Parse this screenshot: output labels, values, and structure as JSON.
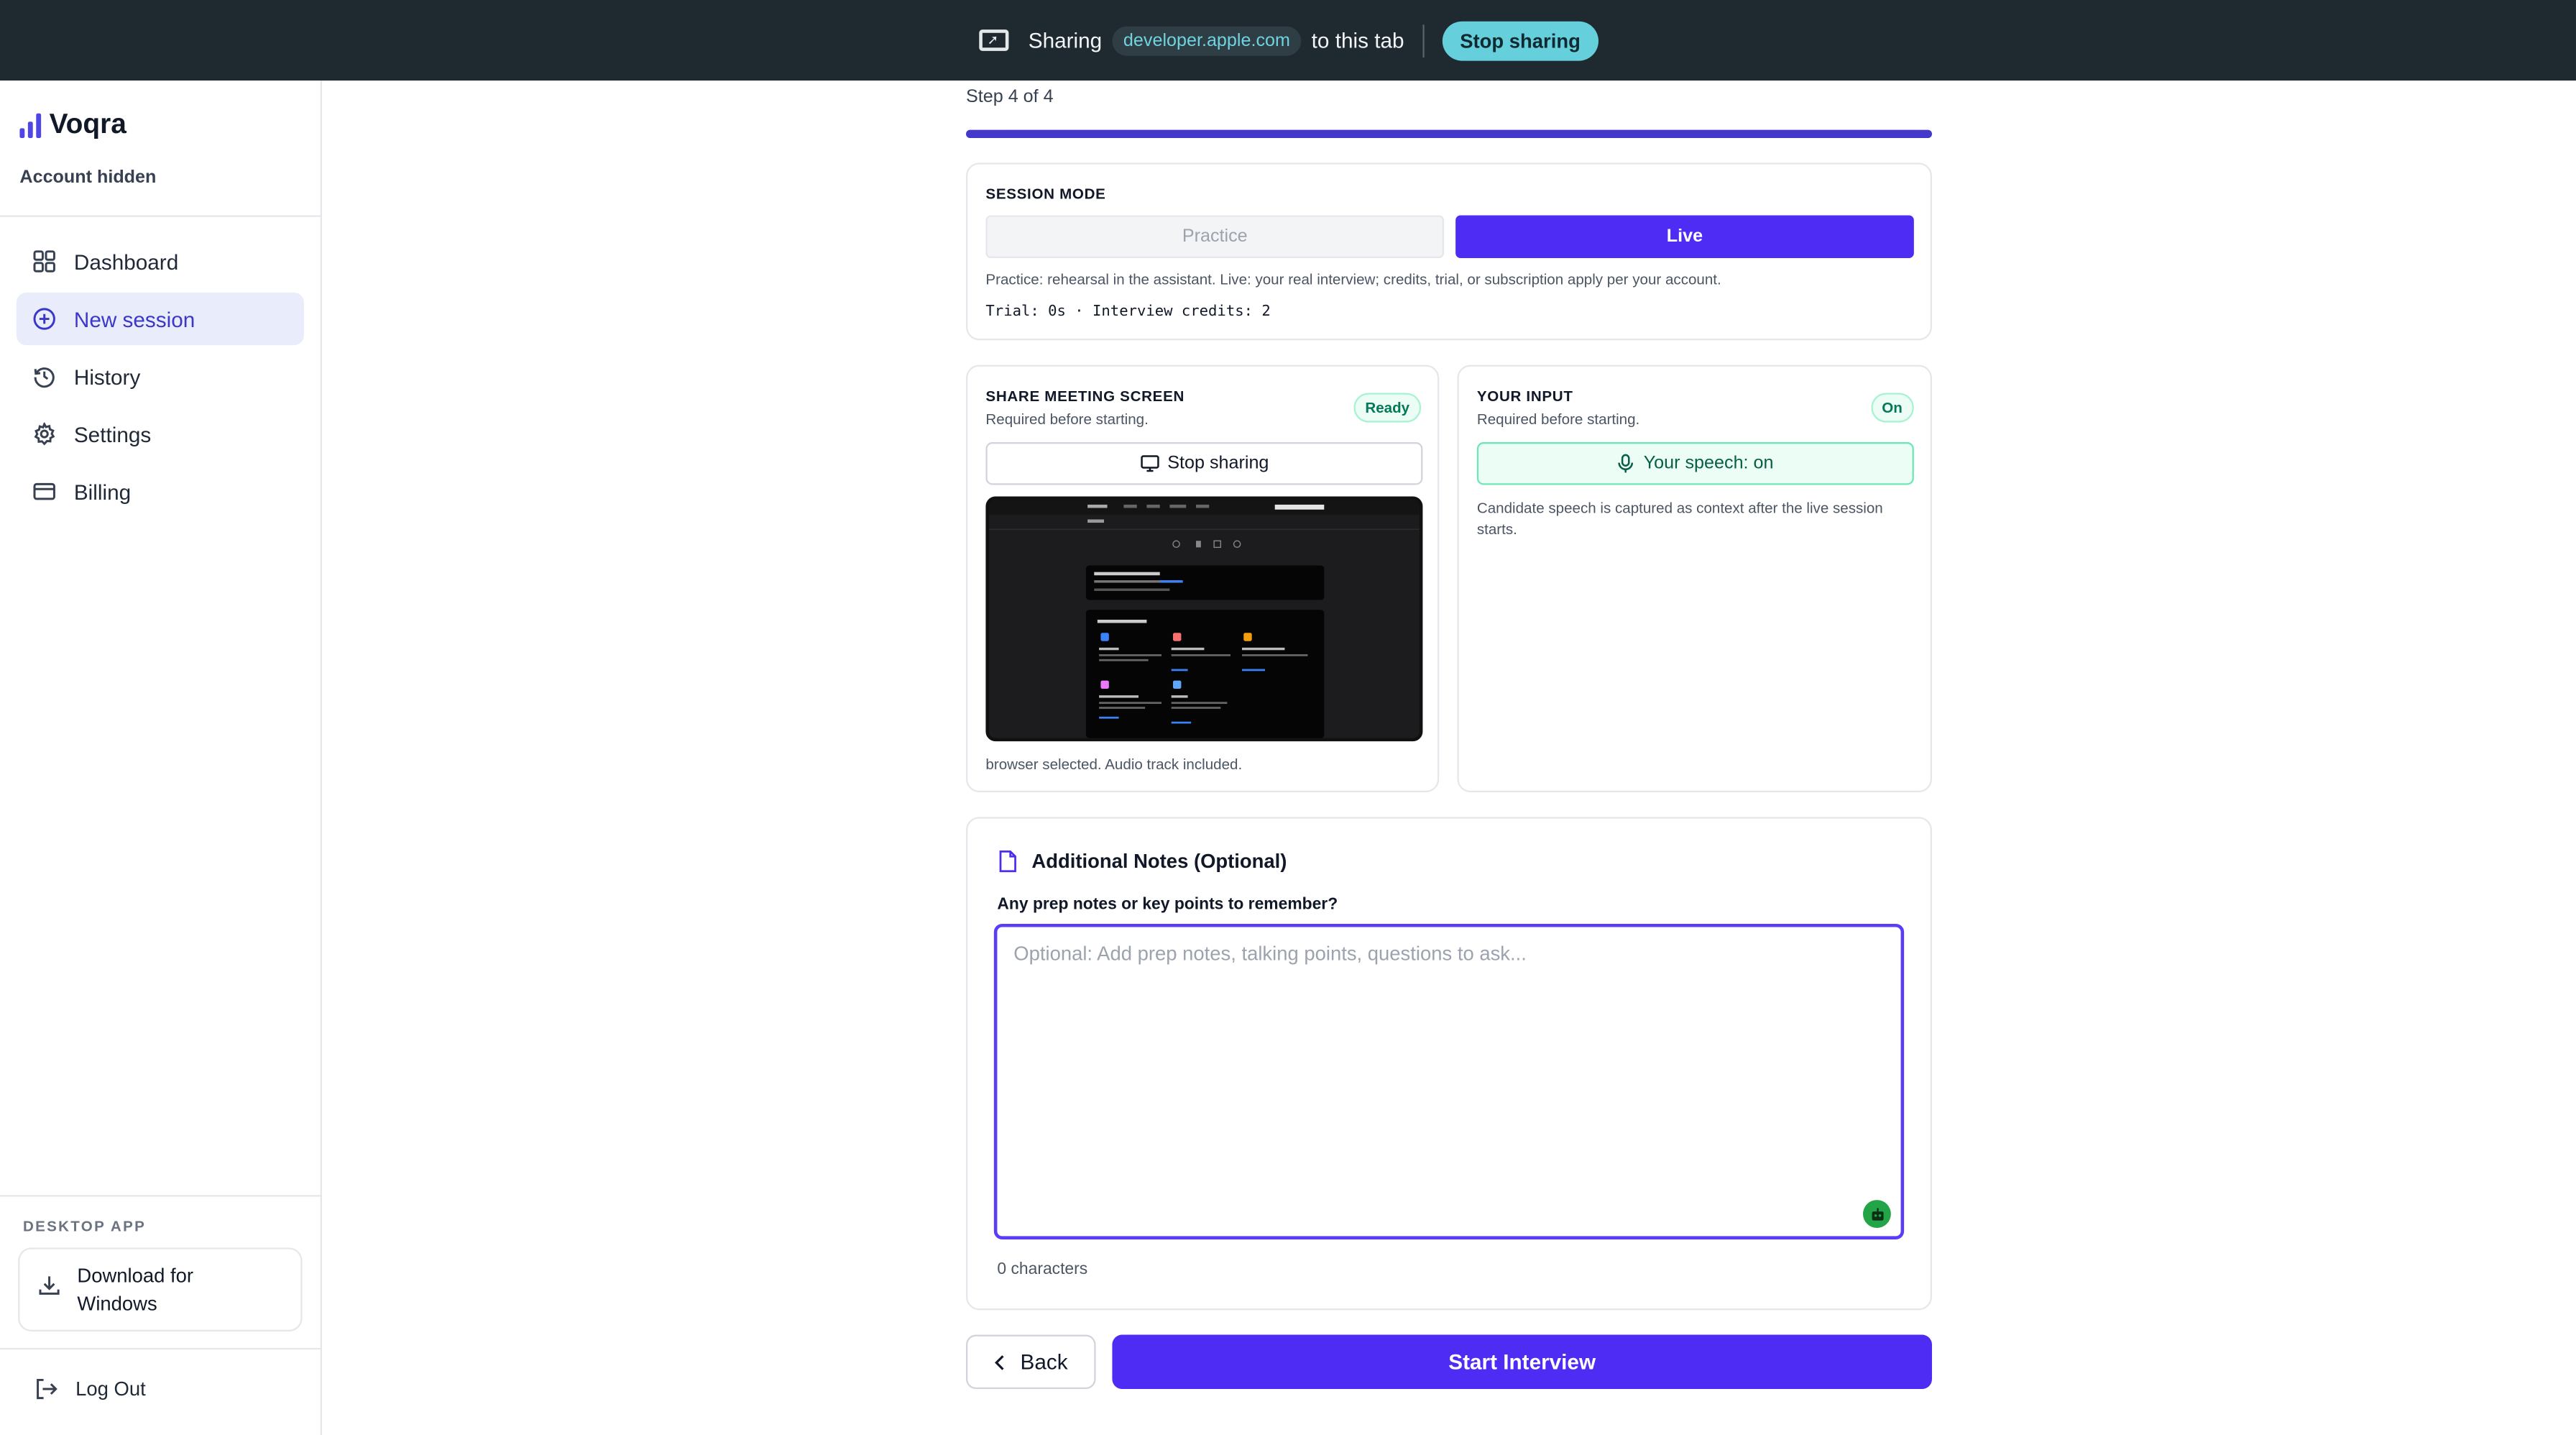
{
  "share_bar": {
    "prefix": "Sharing",
    "domain": "developer.apple.com",
    "suffix": "to this tab",
    "stop_label": "Stop sharing"
  },
  "sidebar": {
    "brand": "Voqra",
    "account": "Account hidden",
    "items": [
      {
        "label": "Dashboard",
        "icon": "grid-icon",
        "active": false
      },
      {
        "label": "New session",
        "icon": "plus-circle-icon",
        "active": true
      },
      {
        "label": "History",
        "icon": "history-icon",
        "active": false
      },
      {
        "label": "Settings",
        "icon": "gear-icon",
        "active": false
      },
      {
        "label": "Billing",
        "icon": "card-icon",
        "active": false
      }
    ],
    "desktop_label": "DESKTOP APP",
    "download_label": "Download for Windows",
    "logout_label": "Log Out"
  },
  "main": {
    "step": "Step 4 of 4",
    "progress": 1.0,
    "session_mode": {
      "title": "SESSION MODE",
      "practice_label": "Practice",
      "live_label": "Live",
      "selected": "Live",
      "description": "Practice: rehearsal in the assistant. Live: your real interview; credits, trial, or subscription apply per your account.",
      "credits": "Trial: 0s · Interview credits: 2"
    },
    "share_screen": {
      "title": "SHARE MEETING SCREEN",
      "subtitle": "Required before starting.",
      "badge": "Ready",
      "button_label": "Stop sharing",
      "footnote": "browser selected. Audio track included."
    },
    "your_input": {
      "title": "YOUR INPUT",
      "subtitle": "Required before starting.",
      "badge": "On",
      "button_label": "Your speech: on",
      "note": "Candidate speech is captured as context after the live session starts."
    },
    "notes": {
      "title": "Additional Notes (Optional)",
      "question": "Any prep notes or key points to remember?",
      "placeholder": "Optional: Add prep notes, talking points, questions to ask...",
      "value": "",
      "count": "0 characters"
    },
    "back_label": "Back",
    "start_label": "Start Interview"
  },
  "colors": {
    "accent": "#4f2cf3",
    "topbar": "#1f2a30",
    "share_pill": "#66cfdc",
    "ready_green": "#047857"
  }
}
